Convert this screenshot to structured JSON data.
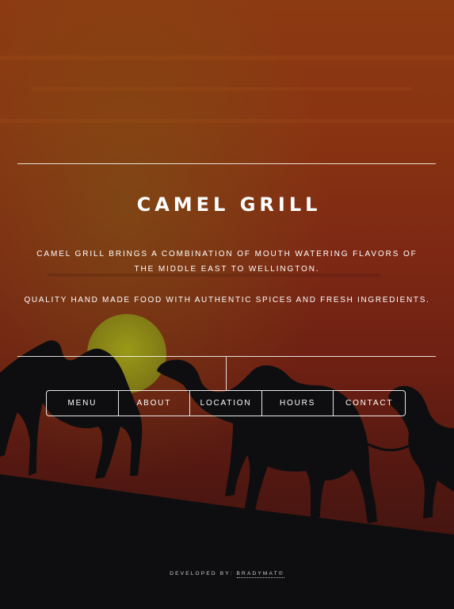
{
  "site": {
    "title": "CAMEL GRILL",
    "intro": "CAMEL GRILL BRINGS A COMBINATION OF MOUTH WATERING FLAVORS OF THE MIDDLE EAST TO WELLINGTON.",
    "tagline": "QUALITY HAND MADE FOOD WITH AUTHENTIC SPICES AND FRESH INGREDIENTS."
  },
  "nav": {
    "items": [
      {
        "label": "MENU"
      },
      {
        "label": "ABOUT"
      },
      {
        "label": "LOCATION"
      },
      {
        "label": "HOURS"
      },
      {
        "label": "CONTACT"
      }
    ]
  },
  "footer": {
    "prefix": "DEVELOPED BY:",
    "link_text": "BRADYMAT©"
  },
  "colors": {
    "sky_top": "#8e3a12",
    "sky_mid": "#7a2414",
    "sky_low": "#5a1810",
    "sun": "#8a8a16",
    "ground": "#0d0d0f",
    "text": "#ffffff"
  }
}
